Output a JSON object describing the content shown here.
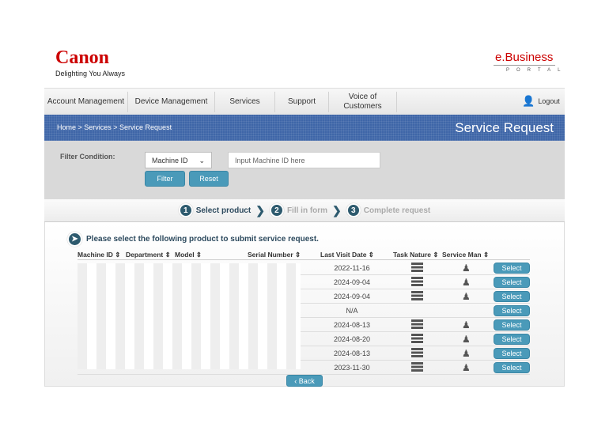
{
  "header": {
    "logo": "Canon",
    "tagline": "Delighting You Always",
    "portal_logo": "e.Business",
    "portal_sub": "PORTAL"
  },
  "nav": {
    "items": [
      "Account Management",
      "Device Management",
      "Services",
      "Support",
      "Voice of Customers"
    ],
    "logout": "Logout"
  },
  "banner": {
    "breadcrumb": "Home > Services > Service Request",
    "title": "Service Request"
  },
  "filter": {
    "label": "Filter Condition:",
    "select_value": "Machine ID",
    "input_placeholder": "Input Machine ID here",
    "filter_button": "Filter",
    "reset_button": "Reset"
  },
  "steps": [
    {
      "num": "1",
      "label": "Select product",
      "active": true
    },
    {
      "num": "2",
      "label": "Fill in form",
      "active": false
    },
    {
      "num": "3",
      "label": "Complete request",
      "active": false
    }
  ],
  "instruction": "Please select the following product to submit service request.",
  "table": {
    "headers": [
      "Machine ID",
      "Department",
      "Model",
      "Serial Number",
      "Last Visit Date",
      "Task Nature",
      "Service Man"
    ],
    "rows": [
      {
        "date": "2022-11-16",
        "task": true,
        "man": true
      },
      {
        "date": "2024-09-04",
        "task": true,
        "man": true
      },
      {
        "date": "2024-09-04",
        "task": true,
        "man": true
      },
      {
        "date": "N/A",
        "task": false,
        "man": false
      },
      {
        "date": "2024-08-13",
        "task": true,
        "man": true
      },
      {
        "date": "2024-08-20",
        "task": true,
        "man": true
      },
      {
        "date": "2024-08-13",
        "task": true,
        "man": true
      },
      {
        "date": "2023-11-30",
        "task": true,
        "man": true
      }
    ],
    "select_label": "Select"
  },
  "back_button": "‹ Back",
  "colors": {
    "brand": "#cc0000",
    "banner": "#3f66a8",
    "button": "#4a9ab9",
    "step": "#2d5a6e"
  }
}
